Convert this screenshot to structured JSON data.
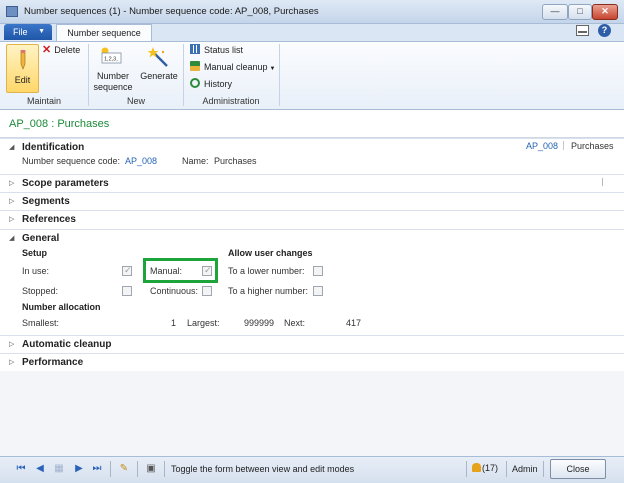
{
  "window": {
    "title": "Number sequences (1) - Number sequence code: AP_008, Purchases",
    "min_glyph": "—",
    "max_glyph": "□",
    "close_glyph": "✕"
  },
  "ribbon": {
    "file_tab": "File",
    "active_tab": "Number sequence",
    "help_glyph": "?",
    "maintain": {
      "label": "Maintain",
      "edit": "Edit",
      "delete": "Delete"
    },
    "new": {
      "label": "New",
      "number_sequence": "Number sequence",
      "generate": "Generate",
      "icon_text": "1,2,3,"
    },
    "administration": {
      "label": "Administration",
      "status_list": "Status list",
      "manual_cleanup": "Manual cleanup",
      "history": "History"
    }
  },
  "form": {
    "title": "AP_008 : Purchases",
    "identification": {
      "header": "Identification",
      "summary_code": "AP_008",
      "summary_name": "Purchases",
      "code_label": "Number sequence code:",
      "code_value": "AP_008",
      "name_label": "Name:",
      "name_value": "Purchases"
    },
    "collapsed_tabs": [
      "Scope parameters",
      "Segments",
      "References"
    ],
    "general": {
      "header": "General",
      "setup_label": "Setup",
      "in_use_label": "In use:",
      "in_use": true,
      "stopped_label": "Stopped:",
      "stopped": false,
      "manual_label": "Manual:",
      "manual": true,
      "continuous_label": "Continuous:",
      "continuous": false,
      "allow_label": "Allow user changes",
      "lower_label": "To a lower number:",
      "lower": false,
      "higher_label": "To a higher number:",
      "higher": false,
      "allocation_label": "Number allocation",
      "smallest_label": "Smallest:",
      "smallest_value": "1",
      "largest_label": "Largest:",
      "largest_value": "999999",
      "next_label": "Next:",
      "next_value": "417"
    },
    "bottom_tabs": [
      "Automatic cleanup",
      "Performance"
    ]
  },
  "statusbar": {
    "message": "Toggle the form between view and edit modes",
    "notifications": "(17)",
    "user": "Admin",
    "close": "Close"
  },
  "colors": {
    "accent": "#1da53c",
    "title_green": "#1c8a3a",
    "link_blue": "#2463b3"
  }
}
